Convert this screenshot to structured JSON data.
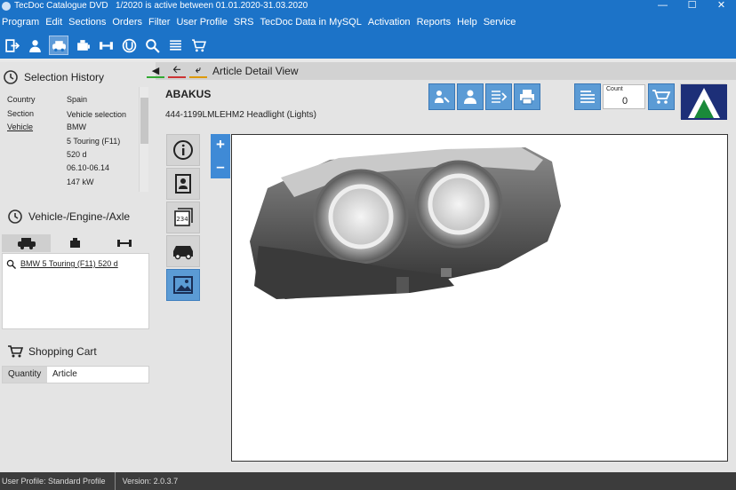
{
  "window": {
    "title": "TecDoc Catalogue DVD",
    "subtitle": "1/2020 is active between 01.01.2020-31.03.2020"
  },
  "menu": [
    "Program",
    "Edit",
    "Sections",
    "Orders",
    "Filter",
    "User Profile",
    "SRS",
    "TecDoc Data in MySQL",
    "Activation",
    "Reports",
    "Help",
    "Service"
  ],
  "selection_history": {
    "title": "Selection History",
    "rows": [
      {
        "label": "Country",
        "value": "Spain"
      },
      {
        "label": "Section",
        "value": "Vehicle selection"
      },
      {
        "label": "Vehicle",
        "value": "BMW"
      }
    ],
    "extra_values": [
      "5 Touring (F11)",
      "520 d",
      "06.10-06.14",
      "147 kW"
    ]
  },
  "vehicle_engine": {
    "title": "Vehicle-/Engine-/Axle",
    "result": "BMW 5 Touring (F11) 520 d"
  },
  "cart": {
    "title": "Shopping Cart",
    "col_quantity": "Quantity",
    "col_article": "Article"
  },
  "article": {
    "view_title": "Article Detail View",
    "brand": "ABAKUS",
    "description": "444-1199LMLEHM2 Headlight (Lights)",
    "count_label": "Count",
    "count_value": "0"
  },
  "status": {
    "profile": "User Profile: Standard Profile",
    "version": "Version: 2.0.3.7"
  },
  "icons": [
    "program-icon",
    "user-icon",
    "vehicle-select-icon",
    "engine-icon",
    "axle-icon",
    "brand-icon",
    "search-icon",
    "list-icon",
    "cart-icon"
  ]
}
